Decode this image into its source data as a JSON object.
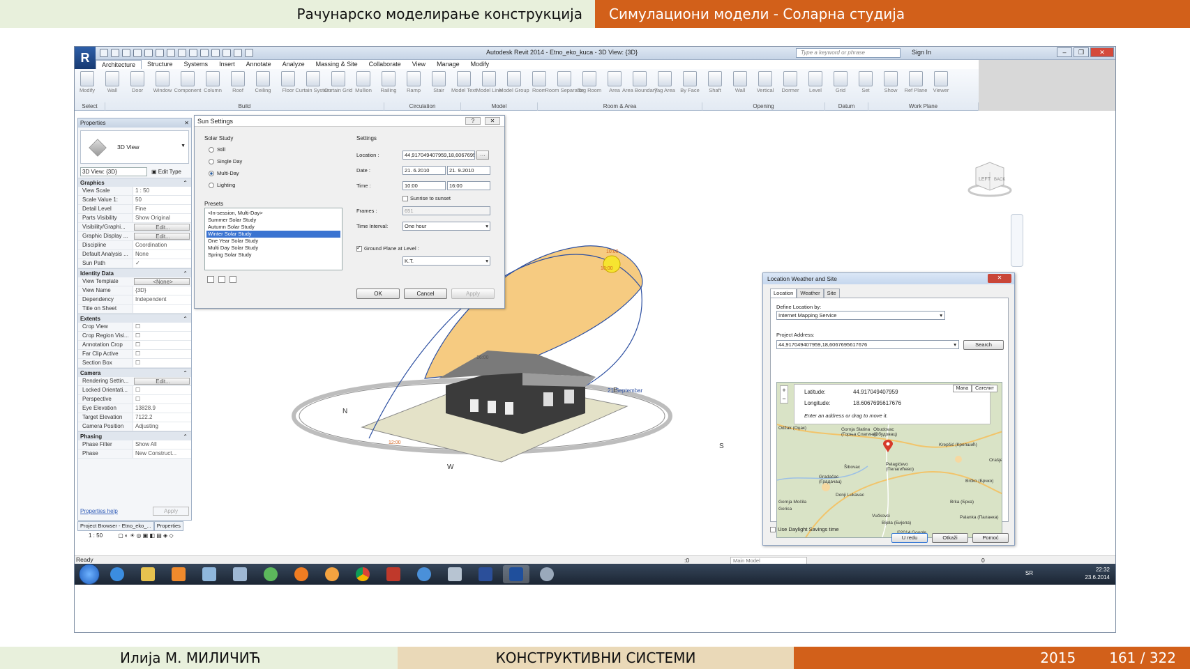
{
  "slide": {
    "header_left": "Рачунарско моделирање конструкција",
    "header_right": "Симулациони модели - Соларна студија",
    "footer_author": "Илија М. МИЛИЧИЋ",
    "footer_course": "КОНСТРУКТИВНИ СИСТЕМИ",
    "footer_year": "2015",
    "footer_page": "161 / 322"
  },
  "app": {
    "title": "Autodesk Revit 2014 -   Etno_eko_kuca - 3D View: {3D}",
    "search_placeholder": "Type a keyword or phrase",
    "signin": "Sign In",
    "tabs": [
      "Architecture",
      "Structure",
      "Systems",
      "Insert",
      "Annotate",
      "Analyze",
      "Massing & Site",
      "Collaborate",
      "View",
      "Manage",
      "Modify"
    ],
    "tools": [
      "Modify",
      "Wall",
      "Door",
      "Window",
      "Component",
      "Column",
      "Roof",
      "Ceiling",
      "Floor",
      "Curtain System",
      "Curtain Grid",
      "Mullion",
      "Railing",
      "Ramp",
      "Stair",
      "Model Text",
      "Model Line",
      "Model Group",
      "Room",
      "Room Separator",
      "Tag Room",
      "Area",
      "Area Boundary",
      "Tag Area",
      "By Face",
      "Shaft",
      "Wall",
      "Vertical",
      "Dormer",
      "Level",
      "Grid",
      "Set",
      "Show",
      "Ref Plane",
      "Viewer"
    ],
    "groups": [
      "Select",
      "Build",
      "Circulation",
      "Model",
      "Room & Area",
      "Opening",
      "Datum",
      "Work Plane"
    ]
  },
  "properties": {
    "title": "Properties",
    "type_name": "3D View",
    "view_select": "3D View: {3D}",
    "edit_type": "Edit Type",
    "sections": [
      {
        "name": "Graphics",
        "rows": [
          {
            "k": "View Scale",
            "v": "1 : 50"
          },
          {
            "k": "Scale Value    1:",
            "v": "50"
          },
          {
            "k": "Detail Level",
            "v": "Fine"
          },
          {
            "k": "Parts Visibility",
            "v": "Show Original"
          },
          {
            "k": "Visibility/Graphi...",
            "v": "Edit...",
            "btn": true
          },
          {
            "k": "Graphic Display ...",
            "v": "Edit...",
            "btn": true
          },
          {
            "k": "Discipline",
            "v": "Coordination"
          },
          {
            "k": "Default Analysis ...",
            "v": "None"
          },
          {
            "k": "Sun Path",
            "v": "✓"
          }
        ]
      },
      {
        "name": "Identity Data",
        "rows": [
          {
            "k": "View Template",
            "v": "<None>",
            "btn": true
          },
          {
            "k": "View Name",
            "v": "{3D}"
          },
          {
            "k": "Dependency",
            "v": "Independent"
          },
          {
            "k": "Title on Sheet",
            "v": ""
          }
        ]
      },
      {
        "name": "Extents",
        "rows": [
          {
            "k": "Crop View",
            "v": "☐"
          },
          {
            "k": "Crop Region Visi...",
            "v": "☐"
          },
          {
            "k": "Annotation Crop",
            "v": "☐"
          },
          {
            "k": "Far Clip Active",
            "v": "☐"
          },
          {
            "k": "Section Box",
            "v": "☐"
          }
        ]
      },
      {
        "name": "Camera",
        "rows": [
          {
            "k": "Rendering Settin...",
            "v": "Edit...",
            "btn": true
          },
          {
            "k": "Locked Orientati...",
            "v": "☐"
          },
          {
            "k": "Perspective",
            "v": "☐"
          },
          {
            "k": "Eye Elevation",
            "v": "13828.9"
          },
          {
            "k": "Target Elevation",
            "v": "7122.2"
          },
          {
            "k": "Camera Position",
            "v": "Adjusting"
          }
        ]
      },
      {
        "name": "Phasing",
        "rows": [
          {
            "k": "Phase Filter",
            "v": "Show All"
          },
          {
            "k": "Phase",
            "v": "New Construct..."
          }
        ]
      }
    ],
    "help_link": "Properties help",
    "apply": "Apply",
    "bottom_tabs": [
      "Project Browser - Etno_eko_...",
      "Properties"
    ]
  },
  "sun_settings": {
    "title": "Sun Settings",
    "solar_study_label": "Solar Study",
    "options": [
      {
        "label": "Still",
        "selected": false
      },
      {
        "label": "Single Day",
        "selected": false
      },
      {
        "label": "Multi-Day",
        "selected": true
      },
      {
        "label": "Lighting",
        "selected": false
      }
    ],
    "presets_label": "Presets",
    "presets": [
      "<In-session, Multi-Day>",
      "Summer Solar Study",
      "Autumn Solar Study",
      "Winter Solar Study",
      "One Year Solar Study",
      "Multi Day Solar Study",
      "Spring Solar Study"
    ],
    "selected_preset": "Winter Solar Study",
    "settings_label": "Settings",
    "location_label": "Location :",
    "location_value": "44,917049407959,18,6067695",
    "date_label": "Date :",
    "date_from": "21.  6.2010",
    "date_to": "21.  9.2010",
    "time_label": "Time :",
    "time_from": "10:00",
    "time_to": "16:00",
    "sunrise_label": "Sunrise to sunset",
    "frames_label": "Frames :",
    "frames_value": "651",
    "interval_label": "Time Interval:",
    "interval_value": "One hour",
    "ground_plane_label": "Ground Plane at Level :",
    "ground_plane_level": "K.T.",
    "ok": "OK",
    "cancel": "Cancel",
    "apply": "Apply"
  },
  "location_dialog": {
    "title": "Location Weather and Site",
    "tabs": [
      "Location",
      "Weather",
      "Site"
    ],
    "define_label": "Define Location by:",
    "define_value": "Internet Mapping Service",
    "address_label": "Project Address:",
    "address_value": "44,917049407959,18,6067695617676",
    "search": "Search",
    "latitude_label": "Latitude:",
    "latitude_value": "44.917049407959",
    "longitude_label": "Longitude:",
    "longitude_value": "18.6067695617676",
    "hint": "Enter an address or drag to move it.",
    "map_type_1": "Мапа",
    "map_type_2": "Сателит",
    "towns": [
      "Odžak (Оџак)",
      "Gornja Slatina (Горња Слатина)",
      "Obudovac (Обудовац)",
      "Krepšić (Крепшић)",
      "Šibovac",
      "Pelagićevo (Пелагићево)",
      "Gradačac (Градачац)",
      "Brčko (Брчко)",
      "Donji Lukavac",
      "Vučkovci",
      "Brka (Брка)",
      "Gornja Močila",
      "Bijela (Бијела)",
      "Palanka (Паланка)",
      "Orašje",
      "Gorica"
    ],
    "copyright": "©2014 Google",
    "daylight": "Use Daylight Savings time",
    "ok": "U redu",
    "cancel": "Otkaži",
    "help": "Pomoć"
  },
  "canvas": {
    "compass_n": "N",
    "compass_s": "S",
    "compass_w": "W",
    "compass_e": "E",
    "sun_time_top": "10:00",
    "sun_time_mid": "10:00",
    "sun_path_label": "21 Septembar",
    "arc_label_left": "16:00",
    "arc_label_low": "12:00",
    "viewcube_left": "LEFT",
    "viewcube_right": "BACK"
  },
  "status": {
    "ready": "Ready",
    "scale": "1 : 50",
    "main_model": "Main Model",
    "zero": ":0",
    "filter": "0"
  },
  "taskbar": {
    "lang": "SR",
    "time": "22:32",
    "date": "23.6.2014"
  }
}
